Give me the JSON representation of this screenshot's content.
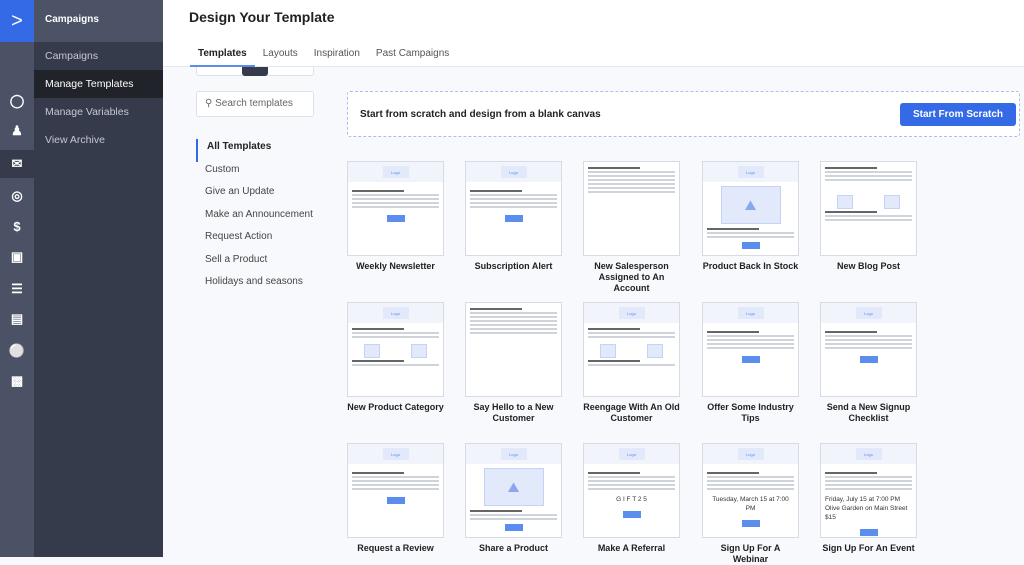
{
  "rail": {
    "icons": [
      "brand-logo-icon",
      "search-icon",
      "lightbulb-icon",
      "contacts-icon",
      "mail-icon",
      "target-icon",
      "dollar-icon",
      "chat-icon",
      "list-icon",
      "document-icon",
      "globe-icon",
      "chart-icon"
    ]
  },
  "subnav": {
    "header": "Campaigns",
    "items": [
      {
        "label": "Campaigns"
      },
      {
        "label": "Manage Templates",
        "active": true
      },
      {
        "label": "Manage Variables"
      },
      {
        "label": "View Archive"
      }
    ]
  },
  "page": {
    "title": "Design Your Template"
  },
  "tabs": [
    {
      "label": "Templates",
      "active": true
    },
    {
      "label": "Layouts"
    },
    {
      "label": "Inspiration"
    },
    {
      "label": "Past Campaigns"
    }
  ],
  "search": {
    "placeholder": "Search templates"
  },
  "categories": [
    {
      "label": "All Templates",
      "active": true
    },
    {
      "label": "Custom"
    },
    {
      "label": "Give an Update"
    },
    {
      "label": "Make an Announcement"
    },
    {
      "label": "Request Action"
    },
    {
      "label": "Sell a Product"
    },
    {
      "label": "Holidays and seasons"
    }
  ],
  "scratch": {
    "text": "Start from scratch and design from a blank canvas",
    "button": "Start From Scratch"
  },
  "thumb_logo": "Logo",
  "colors": {
    "accent": "#356ae6",
    "rail": "#4b5266",
    "subnav": "#363b4c"
  },
  "templates": [
    {
      "name": "Weekly Newsletter",
      "type": "logo-text"
    },
    {
      "name": "Subscription Alert",
      "type": "logo-text"
    },
    {
      "name": "New Salesperson Assigned to An Account",
      "type": "plain"
    },
    {
      "name": "Product Back In Stock",
      "type": "image"
    },
    {
      "name": "New Blog Post",
      "type": "two-images-plain"
    },
    {
      "name": "New Product Category",
      "type": "two-images"
    },
    {
      "name": "Say Hello to a New Customer",
      "type": "plain"
    },
    {
      "name": "Reengage With An Old Customer",
      "type": "two-images"
    },
    {
      "name": "Offer Some Industry Tips",
      "type": "logo-text"
    },
    {
      "name": "Send a New Signup Checklist",
      "type": "logo-text"
    },
    {
      "name": "Request a Review",
      "type": "logo-text"
    },
    {
      "name": "Share a Product",
      "type": "image"
    },
    {
      "name": "Make A Referral",
      "type": "logo-text",
      "big": "G I F T 2 5"
    },
    {
      "name": "Sign Up For A Webinar",
      "type": "logo-text",
      "big": "Tuesday, March 15 at 7:00 PM"
    },
    {
      "name": "Sign Up For An Event",
      "type": "logo-text",
      "big": "Friday, July 15 at 7:00 PM\nOlive Garden on Main Street\n$15"
    }
  ]
}
